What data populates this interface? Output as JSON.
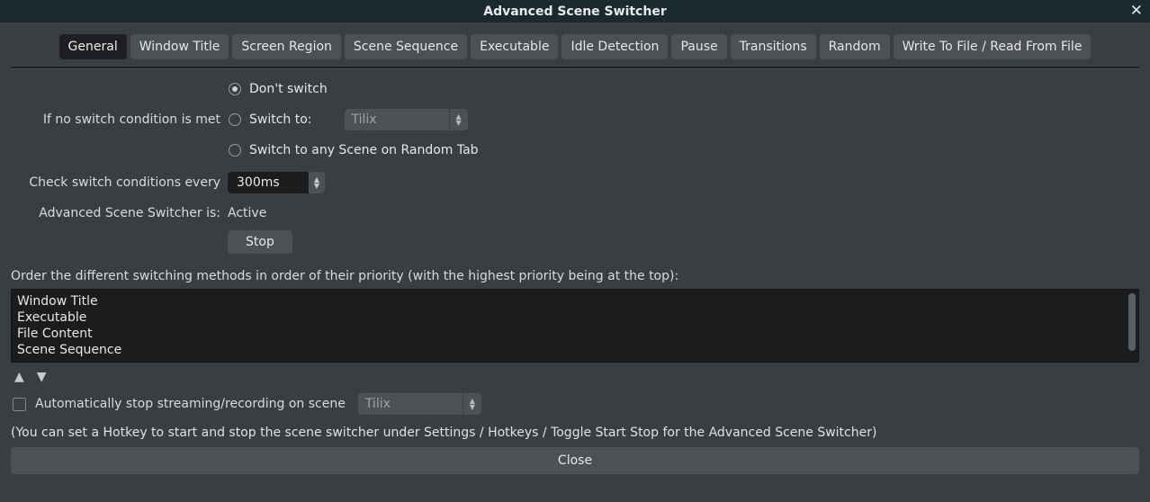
{
  "title": "Advanced Scene Switcher",
  "tabs": {
    "items": [
      "General",
      "Window Title",
      "Screen Region",
      "Scene Sequence",
      "Executable",
      "Idle Detection",
      "Pause",
      "Transitions",
      "Random",
      "Write To File / Read From File"
    ],
    "active": 0
  },
  "noSwitch": {
    "label": "If no switch condition is met",
    "opt_dont": "Don't switch",
    "opt_switch_to": "Switch to:",
    "opt_random": "Switch to any Scene on Random Tab",
    "switch_to_value": "Tilix"
  },
  "checkEvery": {
    "label": "Check switch conditions every",
    "value": "300ms"
  },
  "status": {
    "label": "Advanced Scene Switcher is:",
    "value": "Active",
    "stop_btn": "Stop"
  },
  "order": {
    "label": "Order the different switching methods in order of their priority (with the highest priority being at the top):",
    "items": [
      "Window Title",
      "Executable",
      "File Content",
      "Scene Sequence"
    ]
  },
  "autostop": {
    "label": "Automatically stop streaming/recording on scene",
    "value": "Tilix"
  },
  "hotkey_note": "(You can set a Hotkey to start and stop the scene switcher under Settings / Hotkeys / Toggle Start Stop for the Advanced Scene Switcher)",
  "close_btn": "Close"
}
